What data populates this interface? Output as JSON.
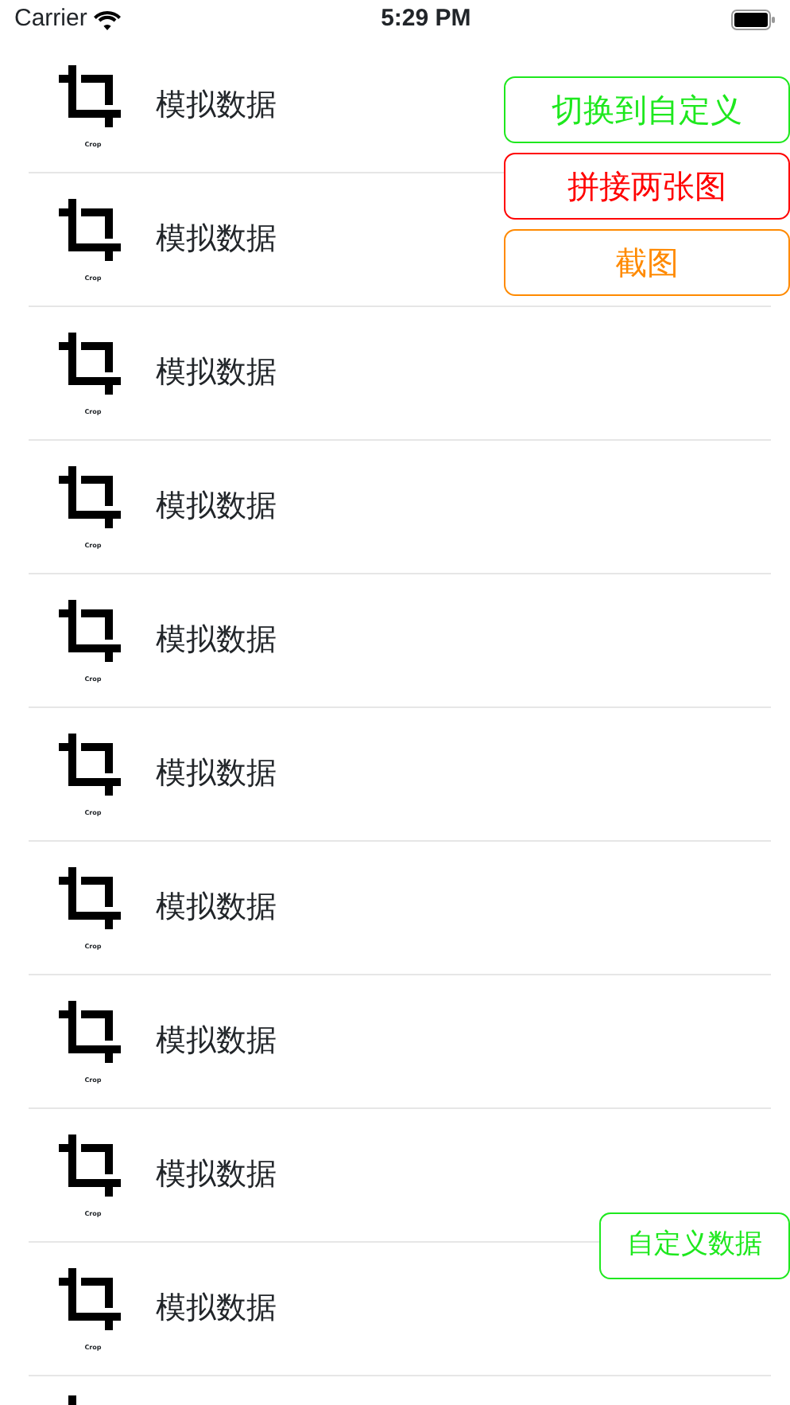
{
  "status_bar": {
    "carrier": "Carrier",
    "time": "5:29 PM"
  },
  "rows": [
    {
      "caption": "Crop",
      "title": "模拟数据"
    },
    {
      "caption": "Crop",
      "title": "模拟数据"
    },
    {
      "caption": "Crop",
      "title": "模拟数据"
    },
    {
      "caption": "Crop",
      "title": "模拟数据"
    },
    {
      "caption": "Crop",
      "title": "模拟数据"
    },
    {
      "caption": "Crop",
      "title": "模拟数据"
    },
    {
      "caption": "Crop",
      "title": "模拟数据"
    },
    {
      "caption": "Crop",
      "title": "模拟数据"
    },
    {
      "caption": "Crop",
      "title": "模拟数据"
    },
    {
      "caption": "Crop",
      "title": "模拟数据"
    }
  ],
  "more_rows_below": true,
  "floating_buttons": [
    {
      "label": "切换到自定义",
      "color": "#1ee81e"
    },
    {
      "label": "拼接两张图",
      "color": "#ff0000"
    },
    {
      "label": "截图",
      "color": "#ff8a00"
    }
  ],
  "bottom_button": {
    "label": "自定义数据",
    "color": "#1ee81e"
  }
}
